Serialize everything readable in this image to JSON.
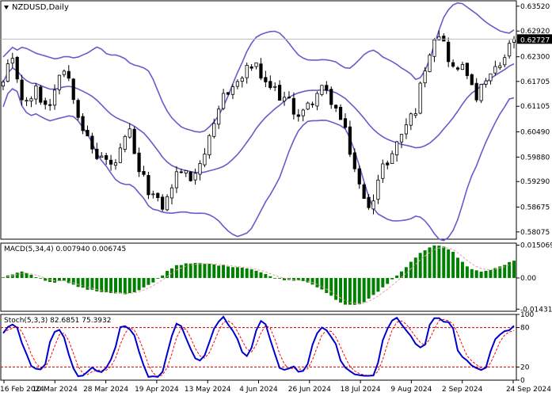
{
  "main": {
    "symbol_label": "NZDUSD,Daily",
    "y_ticks": [
      "0.63520",
      "0.62920",
      "0.62300",
      "0.61705",
      "0.61105",
      "0.60490",
      "0.59880",
      "0.59290",
      "0.58675",
      "0.58075"
    ],
    "last_price": "0.62727"
  },
  "macd": {
    "label": "MACD(5,34,4) 0.007940 0.006745",
    "y_ticks": [
      "0.015069",
      "0.00",
      "-0.014318"
    ]
  },
  "stoch": {
    "label": "Stoch(5,3,3) 82.6851 75.3932",
    "y_ticks": [
      "100",
      "80",
      "20",
      "0"
    ]
  },
  "x_ticks": [
    "16 Feb 2024",
    "10 Mar 2024",
    "28 Mar 2024",
    "19 Apr 2024",
    "13 May 2024",
    "4 Jun 2024",
    "26 Jun 2024",
    "18 Jul 2024",
    "9 Aug 2024",
    "2 Sep 2024",
    "24 Sep 2024"
  ],
  "colors": {
    "candle": "#000000",
    "bollinger": "#6a5acd",
    "macd_hist": "#008000",
    "macd_signal": "#e8a0a0",
    "stoch_main": "#0000cc",
    "stoch_signal": "#ff0000",
    "levels": "#cc0000"
  },
  "chart_data": [
    {
      "type": "candlestick",
      "title": "NZDUSD,Daily",
      "overlay": "Bollinger Bands",
      "ylim": [
        0.579,
        0.6365
      ],
      "close_path": [
        0.6165,
        0.6205,
        0.622,
        0.615,
        0.611,
        0.613,
        0.615,
        0.6125,
        0.611,
        0.613,
        0.6195,
        0.62,
        0.618,
        0.613,
        0.608,
        0.604,
        0.601,
        0.599,
        0.599,
        0.5975,
        0.596,
        0.599,
        0.602,
        0.605,
        0.598,
        0.595,
        0.592,
        0.59,
        0.588,
        0.587,
        0.589,
        0.593,
        0.596,
        0.595,
        0.593,
        0.596,
        0.598,
        0.601,
        0.604,
        0.608,
        0.614,
        0.615,
        0.616,
        0.617,
        0.619,
        0.621,
        0.6205,
        0.618,
        0.615,
        0.616,
        0.614,
        0.613,
        0.612,
        0.61,
        0.609,
        0.61,
        0.612,
        0.614,
        0.615,
        0.614,
        0.612,
        0.609,
        0.606,
        0.601,
        0.596,
        0.591,
        0.587,
        0.588,
        0.592,
        0.596,
        0.598,
        0.6,
        0.603,
        0.606,
        0.608,
        0.61,
        0.616,
        0.622,
        0.626,
        0.63,
        0.627,
        0.623,
        0.62,
        0.619,
        0.623,
        0.616,
        0.613,
        0.615,
        0.617,
        0.619,
        0.62,
        0.622,
        0.625,
        0.6273
      ],
      "last_value": 0.62727
    },
    {
      "type": "bar",
      "title": "MACD(5,34,4)",
      "ylim": [
        -0.0153,
        0.016
      ],
      "main_value": 0.00794,
      "signal_value": 0.006745,
      "histogram_path": [
        0.0,
        0.002,
        0.003,
        0.001,
        -0.001,
        -0.002,
        -0.001,
        -0.0035,
        -0.005,
        -0.006,
        -0.0065,
        -0.007,
        -0.0075,
        -0.0065,
        -0.004,
        -0.001,
        0.003,
        0.006,
        0.0065,
        0.0068,
        0.0065,
        0.006,
        0.0055,
        0.005,
        0.0045,
        0.003,
        0.001,
        -0.0005,
        -0.001,
        -0.001,
        -0.002,
        -0.005,
        -0.008,
        -0.0115,
        -0.0125,
        -0.012,
        -0.009,
        -0.005,
        -0.001,
        0.003,
        0.008,
        0.012,
        0.015,
        0.0145,
        0.012,
        0.007,
        0.0035,
        0.003,
        0.004,
        0.006,
        0.008
      ]
    },
    {
      "type": "line",
      "title": "Stoch(5,3,3)",
      "ylim": [
        0,
        100
      ],
      "levels": [
        80,
        20
      ],
      "series": [
        {
          "name": "main",
          "value": 82.6851
        },
        {
          "name": "signal",
          "value": 75.3932
        }
      ],
      "main_path": [
        70,
        85,
        80,
        50,
        20,
        15,
        20,
        70,
        80,
        60,
        20,
        5,
        10,
        20,
        10,
        20,
        40,
        80,
        82,
        70,
        30,
        5,
        5,
        10,
        50,
        85,
        80,
        50,
        30,
        30,
        60,
        90,
        95,
        80,
        60,
        30,
        50,
        90,
        85,
        50,
        20,
        15,
        20,
        10,
        20,
        60,
        80,
        75,
        60,
        25,
        15,
        10,
        5,
        5,
        10,
        60,
        90,
        95,
        80,
        70,
        50,
        50,
        95,
        93,
        90,
        85,
        40,
        30,
        20,
        15,
        20,
        60,
        70,
        75,
        82.7
      ]
    }
  ]
}
